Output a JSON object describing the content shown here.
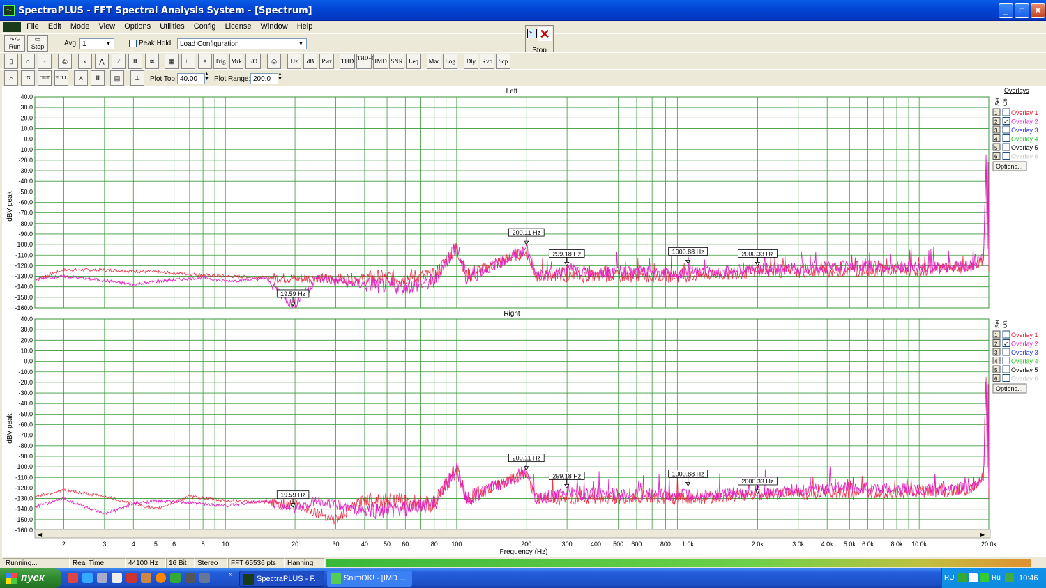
{
  "window": {
    "title": "SpectraPLUS - FFT Spectral Analysis System - [Spectrum]",
    "min": "_",
    "max": "□",
    "close": "✕"
  },
  "menu": [
    "File",
    "Edit",
    "Mode",
    "View",
    "Options",
    "Utilities",
    "Config",
    "License",
    "Window",
    "Help"
  ],
  "toolbar1": {
    "run_label": "Run",
    "stop_label": "Stop",
    "avg_label": "Avg:",
    "avg_value": "1",
    "peak_hold_label": "Peak Hold",
    "config_value": "Load Configuration"
  },
  "popup": {
    "stop_label": "Stop"
  },
  "toolbar2": [
    "Hz",
    "dB",
    "Pwr",
    "THD",
    "THD+N",
    "IMD",
    "SNR",
    "Leq",
    "Mac",
    "Log",
    "Dly",
    "Rvb",
    "Scp",
    "Trig",
    "Mrk",
    "I/O"
  ],
  "toolbar3": {
    "plot_top_label": "Plot Top:",
    "plot_top_value": "40.00",
    "plot_range_label": "Plot Range:",
    "plot_range_value": "200.0"
  },
  "chart_data": [
    {
      "type": "line",
      "title": "Left",
      "ylabel": "dBV peak",
      "xlabel": "",
      "xscale": "log",
      "xlim": [
        1.5,
        20000
      ],
      "ylim": [
        -160,
        40
      ],
      "y_ticks": [
        "40.0",
        "30.0",
        "20.0",
        "10.0",
        "0.0",
        "-10.0",
        "-20.0",
        "-30.0",
        "-40.0",
        "-50.0",
        "-60.0",
        "-70.0",
        "-80.0",
        "-90.0",
        "-100.0",
        "-110.0",
        "-120.0",
        "-130.0",
        "-140.0",
        "-150.0",
        "-160.0"
      ],
      "markers": [
        {
          "label": "19.59 Hz",
          "x": 19.59,
          "y": -158
        },
        {
          "label": "200.11 Hz",
          "x": 200.11,
          "y": -100
        },
        {
          "label": "299.18 Hz",
          "x": 299.18,
          "y": -120
        },
        {
          "label": "1000.88 Hz",
          "x": 1000.88,
          "y": -118
        },
        {
          "label": "2000.33 Hz",
          "x": 2000.33,
          "y": -120
        }
      ],
      "series": [
        {
          "color": "#e8102a",
          "points": [
            [
              1.5,
              -133
            ],
            [
              2,
              -124
            ],
            [
              3,
              -124
            ],
            [
              5,
              -126
            ],
            [
              10,
              -130
            ],
            [
              20,
              -132
            ],
            [
              40,
              -132
            ],
            [
              80,
              -130
            ],
            [
              100,
              -102
            ],
            [
              110,
              -130
            ],
            [
              200,
              -106
            ],
            [
              220,
              -130
            ],
            [
              1000,
              -130
            ],
            [
              2000,
              -126
            ],
            [
              10000,
              -124
            ],
            [
              17000,
              -122
            ],
            [
              19000,
              -115
            ],
            [
              19500,
              -8
            ],
            [
              19700,
              -120
            ],
            [
              19900,
              -8
            ],
            [
              20000,
              -125
            ]
          ]
        },
        {
          "color": "#e020c0",
          "points": [
            [
              1.5,
              -133
            ],
            [
              2,
              -130
            ],
            [
              3,
              -134
            ],
            [
              4,
              -138
            ],
            [
              5,
              -135
            ],
            [
              8,
              -131
            ],
            [
              10,
              -135
            ],
            [
              15,
              -132
            ],
            [
              19.6,
              -158
            ],
            [
              25,
              -132
            ],
            [
              40,
              -138
            ],
            [
              60,
              -140
            ],
            [
              80,
              -135
            ],
            [
              100,
              -100
            ],
            [
              110,
              -132
            ],
            [
              200,
              -104
            ],
            [
              220,
              -130
            ],
            [
              300,
              -125
            ],
            [
              1000,
              -127
            ],
            [
              2000,
              -124
            ],
            [
              5000,
              -120
            ],
            [
              10000,
              -122
            ],
            [
              17000,
              -120
            ],
            [
              19000,
              -110
            ],
            [
              19500,
              -8
            ],
            [
              19700,
              -118
            ],
            [
              19900,
              -8
            ],
            [
              20000,
              -125
            ]
          ]
        }
      ]
    },
    {
      "type": "line",
      "title": "Right",
      "ylabel": "dBV peak",
      "xlabel": "Frequency (Hz)",
      "xscale": "log",
      "xlim": [
        1.5,
        20000
      ],
      "ylim": [
        -160,
        40
      ],
      "y_ticks": [
        "40.0",
        "30.0",
        "20.0",
        "10.0",
        "0.0",
        "-10.0",
        "-20.0",
        "-30.0",
        "-40.0",
        "-50.0",
        "-60.0",
        "-70.0",
        "-80.0",
        "-90.0",
        "-100.0",
        "-110.0",
        "-120.0",
        "-130.0",
        "-140.0",
        "-150.0",
        "-160.0"
      ],
      "x_ticks": [
        "2",
        "3",
        "4",
        "5",
        "6",
        "8",
        "10",
        "20",
        "30",
        "40",
        "50",
        "60",
        "80",
        "100",
        "200",
        "300",
        "400",
        "500",
        "600",
        "800",
        "1.0k",
        "2.0k",
        "3.0k",
        "4.0k",
        "5.0k",
        "6.0k",
        "8.0k",
        "10.0k",
        "20.0k"
      ],
      "x_tick_values": [
        2,
        3,
        4,
        5,
        6,
        8,
        10,
        20,
        30,
        40,
        50,
        60,
        80,
        100,
        200,
        300,
        400,
        500,
        600,
        800,
        1000,
        2000,
        3000,
        4000,
        5000,
        6000,
        8000,
        10000,
        20000
      ],
      "markers": [
        {
          "label": "19.59 Hz",
          "x": 19.59,
          "y": -138
        },
        {
          "label": "200.11 Hz",
          "x": 200.11,
          "y": -103
        },
        {
          "label": "299.18 Hz",
          "x": 299.18,
          "y": -120
        },
        {
          "label": "1000.88 Hz",
          "x": 1000.88,
          "y": -118
        },
        {
          "label": "2000.33 Hz",
          "x": 2000.33,
          "y": -125
        }
      ],
      "series": [
        {
          "color": "#e8102a",
          "points": [
            [
              1.5,
              -128
            ],
            [
              2,
              -122
            ],
            [
              3,
              -128
            ],
            [
              5,
              -140
            ],
            [
              7,
              -128
            ],
            [
              10,
              -132
            ],
            [
              20,
              -135
            ],
            [
              30,
              -150
            ],
            [
              40,
              -130
            ],
            [
              80,
              -135
            ],
            [
              100,
              -102
            ],
            [
              110,
              -130
            ],
            [
              200,
              -106
            ],
            [
              220,
              -130
            ],
            [
              1000,
              -130
            ],
            [
              2000,
              -126
            ],
            [
              10000,
              -124
            ],
            [
              17000,
              -122
            ],
            [
              19000,
              -108
            ],
            [
              19500,
              -7
            ],
            [
              19700,
              -120
            ],
            [
              19900,
              -7
            ],
            [
              20000,
              -125
            ]
          ]
        },
        {
          "color": "#e020c0",
          "points": [
            [
              1.5,
              -138
            ],
            [
              2,
              -130
            ],
            [
              3,
              -145
            ],
            [
              4,
              -135
            ],
            [
              5,
              -132
            ],
            [
              8,
              -135
            ],
            [
              10,
              -137
            ],
            [
              15,
              -132
            ],
            [
              19.6,
              -140
            ],
            [
              25,
              -132
            ],
            [
              40,
              -142
            ],
            [
              60,
              -140
            ],
            [
              80,
              -135
            ],
            [
              100,
              -100
            ],
            [
              110,
              -132
            ],
            [
              200,
              -104
            ],
            [
              220,
              -130
            ],
            [
              300,
              -125
            ],
            [
              1000,
              -127
            ],
            [
              2000,
              -124
            ],
            [
              5000,
              -120
            ],
            [
              10000,
              -122
            ],
            [
              17000,
              -120
            ],
            [
              19000,
              -108
            ],
            [
              19500,
              -7
            ],
            [
              19700,
              -118
            ],
            [
              19900,
              -7
            ],
            [
              20000,
              -125
            ]
          ]
        }
      ]
    }
  ],
  "overlays": {
    "title": "Overlays",
    "set_label": "Set",
    "on_label": "On",
    "items": [
      {
        "num": "1",
        "label": "Overlay 1",
        "color": "#e8102a",
        "checked": false
      },
      {
        "num": "2",
        "label": "Overlay 2",
        "color": "#e020c0",
        "checked": true
      },
      {
        "num": "3",
        "label": "Overlay 3",
        "color": "#2030e0",
        "checked": false
      },
      {
        "num": "4",
        "label": "Overlay 4",
        "color": "#20c020",
        "checked": false
      },
      {
        "num": "5",
        "label": "Overlay 5",
        "color": "#000000",
        "checked": false
      },
      {
        "num": "6",
        "label": "Overlay 6",
        "color": "#c8c8c8",
        "checked": false
      }
    ],
    "options_label": "Options..."
  },
  "status": {
    "state": "Running...",
    "mode": "Real Time",
    "rate": "44100 Hz",
    "bits": "16 Bit",
    "channels": "Stereo",
    "fft": "FFT 65536 pts",
    "window": "Hanning"
  },
  "taskbar": {
    "start": "пуск",
    "tasks": [
      "SpectraPLUS - F...",
      "SnimOK! - [IMD ..."
    ],
    "lang": "RU",
    "lang2": "Ru",
    "time": "10:46"
  }
}
